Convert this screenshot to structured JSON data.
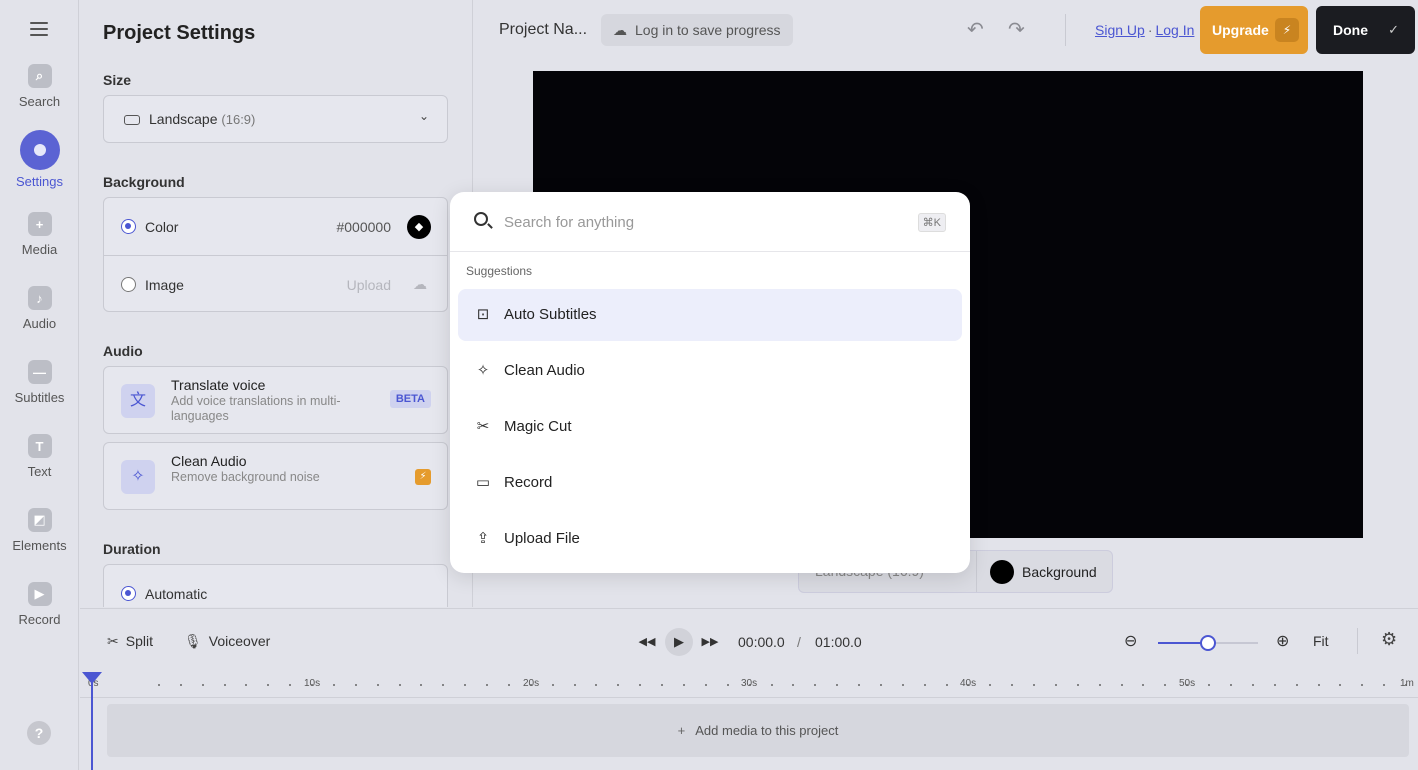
{
  "rail": {
    "items": [
      {
        "label": "Search",
        "glyph": "⌕"
      },
      {
        "label": "Settings",
        "glyph": ""
      },
      {
        "label": "Media",
        "glyph": "+"
      },
      {
        "label": "Audio",
        "glyph": "♪"
      },
      {
        "label": "Subtitles",
        "glyph": "—"
      },
      {
        "label": "Text",
        "glyph": "T"
      },
      {
        "label": "Elements",
        "glyph": "◩"
      },
      {
        "label": "Record",
        "glyph": "▶"
      }
    ],
    "active": "Settings",
    "help": "?"
  },
  "panel": {
    "title": "Project Settings",
    "size_label": "Size",
    "size_value": "Landscape",
    "size_ratio": "(16:9)",
    "background_label": "Background",
    "bg_color_label": "Color",
    "bg_color_hex": "#000000",
    "bg_image_label": "Image",
    "bg_upload_label": "Upload",
    "audio_label": "Audio",
    "translate_title": "Translate voice",
    "translate_desc": "Add voice translations in multi-languages",
    "beta_badge": "BETA",
    "clean_title": "Clean Audio",
    "clean_desc": "Remove background noise",
    "duration_label": "Duration",
    "duration_automatic": "Automatic"
  },
  "topbar": {
    "project_name": "Project Na...",
    "save_prompt": "Log in to save progress",
    "sign_up": "Sign Up",
    "separator": "·",
    "log_in": "Log In",
    "upgrade": "Upgrade",
    "done": "Done"
  },
  "canvas_bar": {
    "landscape": "Landscape (16:9)",
    "background": "Background"
  },
  "search": {
    "placeholder": "Search for anything",
    "shortcut": "⌘K",
    "suggestions_label": "Suggestions",
    "suggestions": [
      {
        "label": "Auto Subtitles",
        "icon": "subtitles-icon",
        "highlighted": true
      },
      {
        "label": "Clean Audio",
        "icon": "sparkle-icon",
        "highlighted": false
      },
      {
        "label": "Magic Cut",
        "icon": "magic-cut-icon",
        "highlighted": false
      },
      {
        "label": "Record",
        "icon": "camera-icon",
        "highlighted": false
      },
      {
        "label": "Upload File",
        "icon": "upload-icon",
        "highlighted": false
      }
    ]
  },
  "timeline": {
    "split": "Split",
    "voiceover": "Voiceover",
    "current_time": "00:00.0",
    "time_separator": "/",
    "total_time": "01:00.0",
    "zoom_level": 0.5,
    "fit": "Fit",
    "ruler_labels": [
      "0s",
      "10s",
      "20s",
      "30s",
      "40s",
      "50s",
      "1m"
    ],
    "add_media": "Add media to this project"
  },
  "colors": {
    "accent": "#4b56d2",
    "upgrade": "#e59b2d",
    "done": "#1b1c21"
  }
}
